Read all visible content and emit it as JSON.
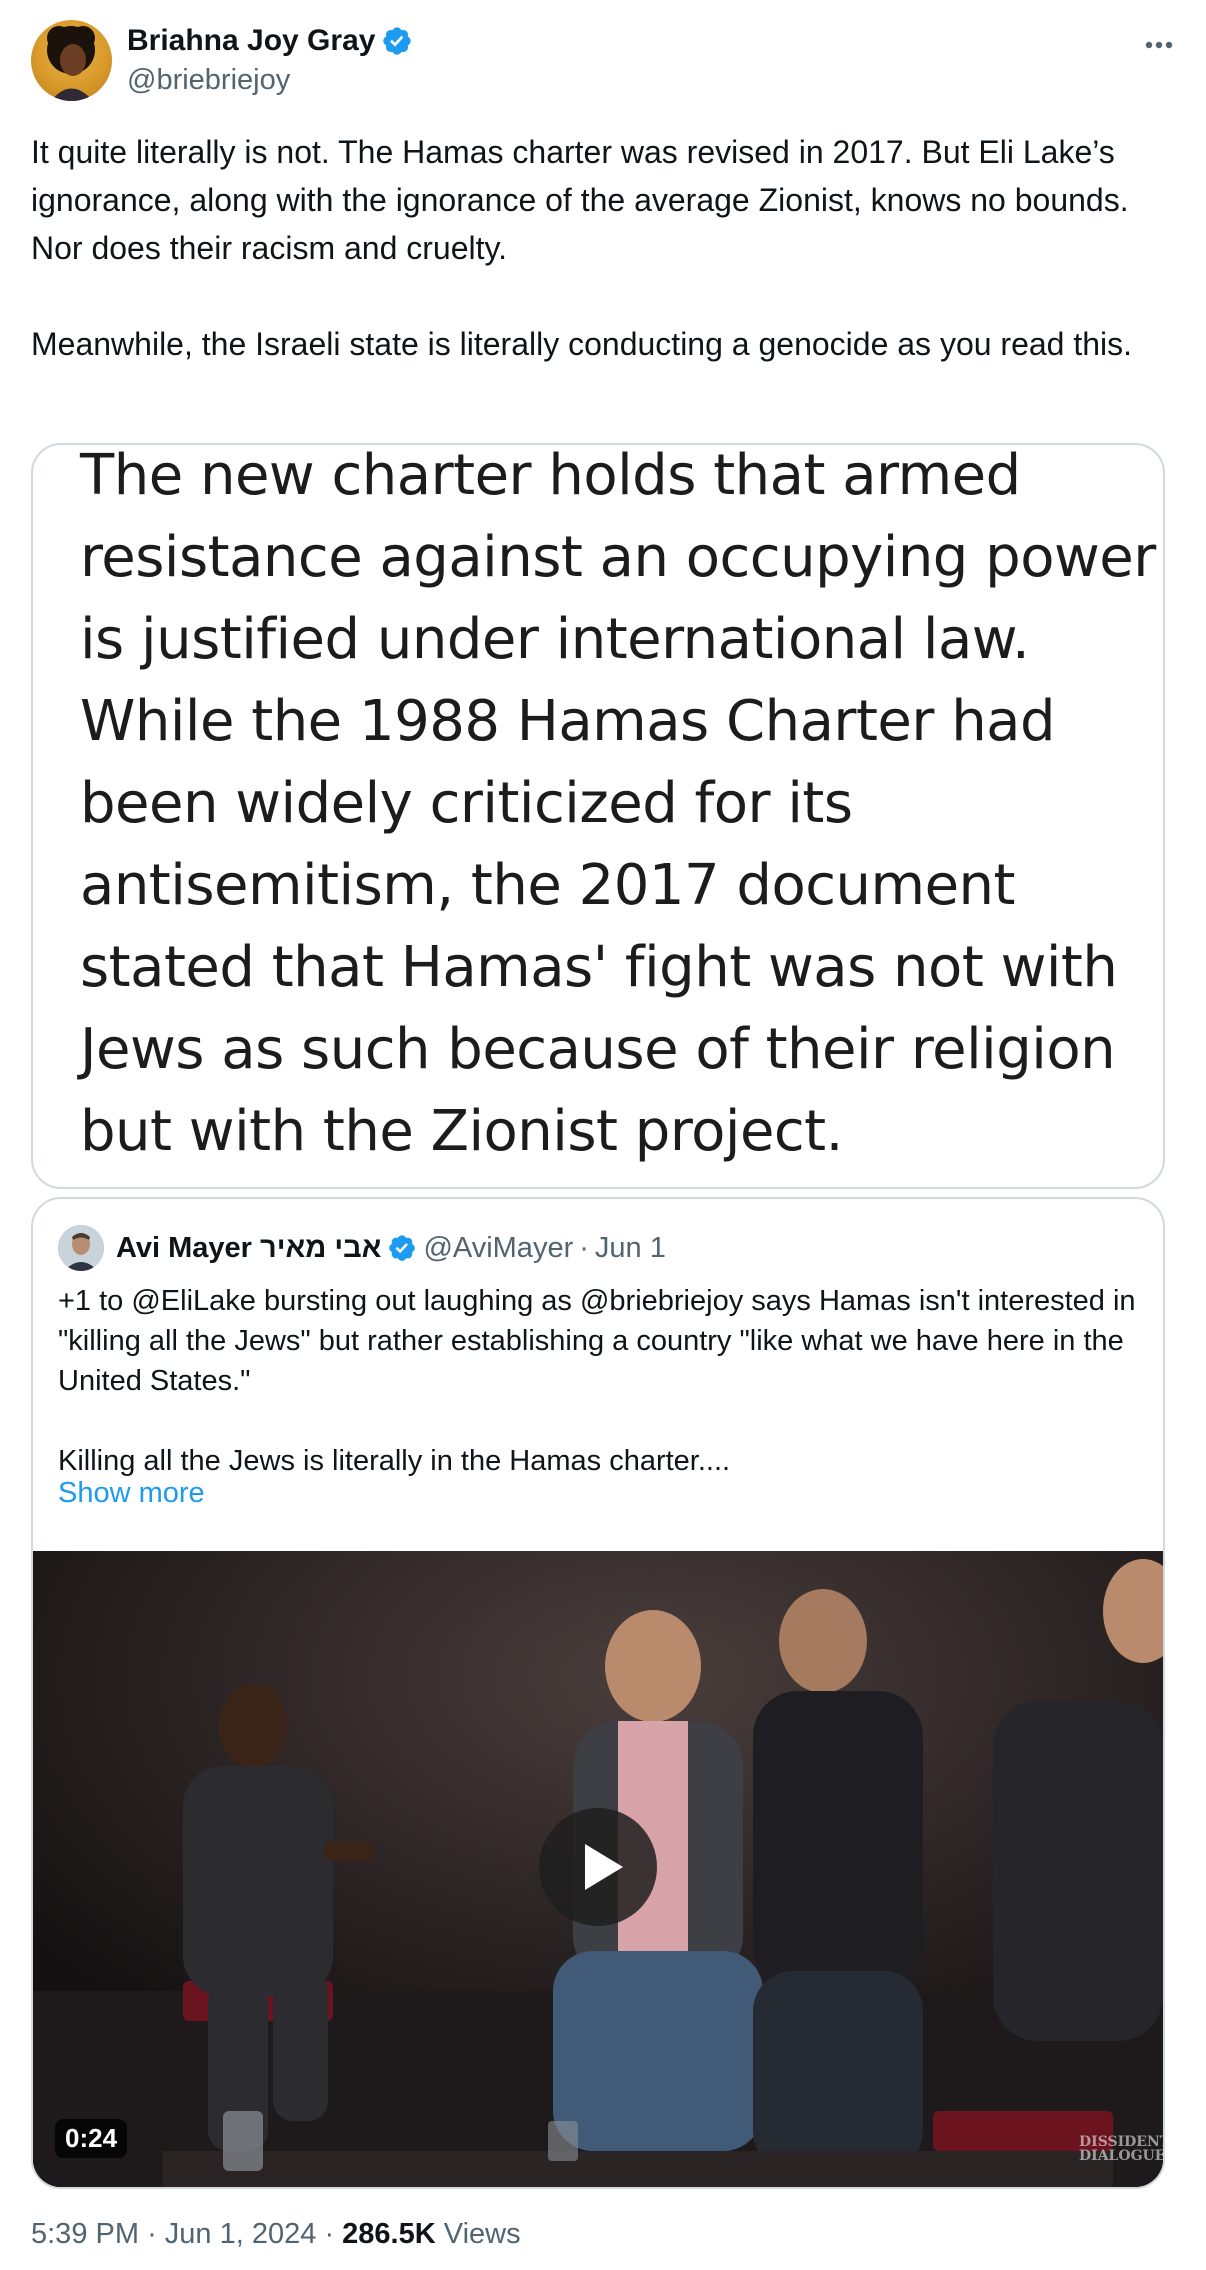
{
  "author": {
    "name": "Briahna Joy Gray",
    "handle": "@briebriejoy",
    "verified_icon": "verified-badge-icon",
    "more_icon": "more-options-icon"
  },
  "tweet": {
    "text": "It quite literally is not. The Hamas charter was revised in 2017. But Eli Lake’s ignorance, along with the ignorance of the average Zionist, knows no bounds. Nor does their racism and cruelty.\n\nMeanwhile, the Israeli state is literally conducting a genocide as you read this."
  },
  "image_card": {
    "text": "The new charter holds that armed resistance against an occupying power is justified under international law. While the 1988 Hamas Charter had been widely criticized for its antisemitism, the 2017 document stated that Hamas' fight was not with Jews as such because of their religion but with the Zionist project."
  },
  "quoted_tweet": {
    "name": "Avi Mayer אבי מאיר",
    "handle": "@AviMayer",
    "separator": "·",
    "date": "Jun 1",
    "text": "+1 to @EliLake bursting out laughing as @briebriejoy says Hamas isn't interested in \"killing all the Jews\" but rather establishing a country \"like what we have here in the United States.\"\n\nKilling all the Jews is literally in the Hamas charter....",
    "show_more": "Show more",
    "video": {
      "duration": "0:24",
      "watermark": "DISSIDENT DIALOGUES"
    }
  },
  "meta": {
    "time": "5:39 PM",
    "date": "Jun 1, 2024",
    "separator": "·",
    "views_count": "286.5K",
    "views_label": "Views"
  },
  "colors": {
    "text": "#0f1419",
    "secondary": "#536471",
    "link": "#1d9bf0",
    "border": "#cfd9de",
    "verified": "#1d9bf0"
  }
}
